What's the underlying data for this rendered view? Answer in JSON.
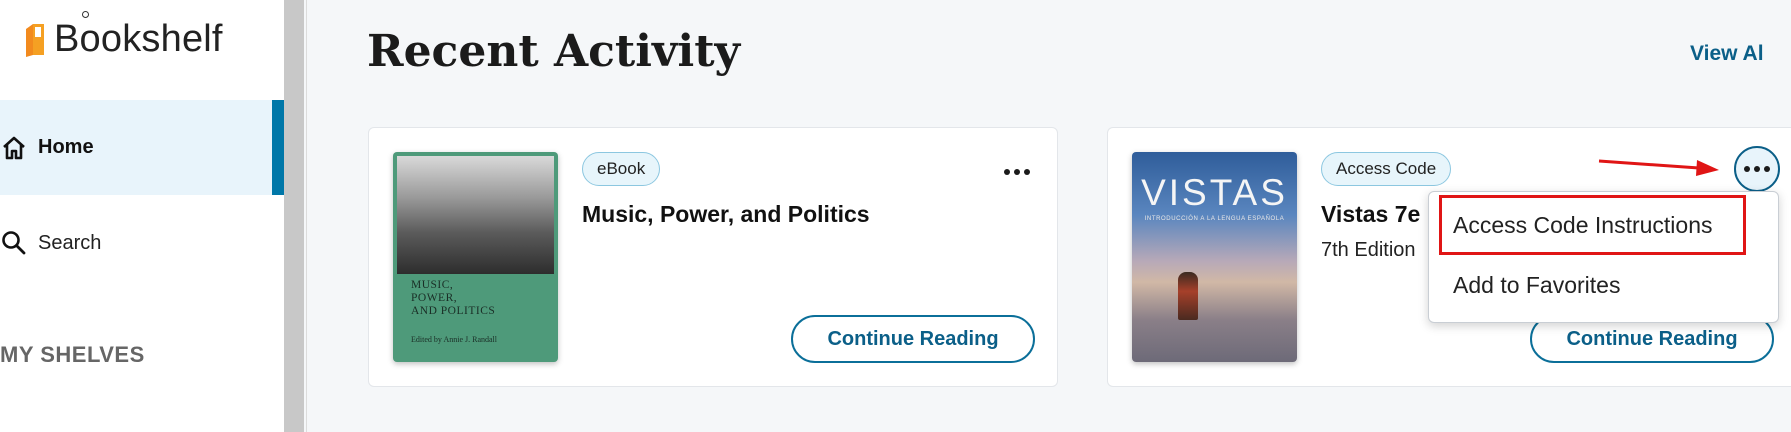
{
  "app": {
    "name": "Bookshelf"
  },
  "sidebar": {
    "items": [
      {
        "label": "Home",
        "icon": "home-icon",
        "active": true
      },
      {
        "label": "Search",
        "icon": "search-icon",
        "active": false
      }
    ],
    "section_heading": "MY SHELVES"
  },
  "main": {
    "title": "Recent Activity",
    "view_all": "View Al",
    "cards": [
      {
        "tag": "eBook",
        "title": "Music, Power, and Politics",
        "edition": "",
        "cover_title_lines": [
          "MUSIC,",
          "POWER,",
          "AND POLITICS"
        ],
        "cover_editor": "Edited by Annie J. Randall",
        "button": "Continue Reading"
      },
      {
        "tag": "Access Code",
        "title": "Vistas 7e",
        "edition": "7th Edition",
        "cover_title": "VISTAS",
        "cover_subtitle": "INTRODUCCIÓN A LA LENGUA ESPAÑOLA",
        "button": "Continue Reading"
      }
    ]
  },
  "menu": {
    "items": [
      "Access Code Instructions",
      "Add to Favorites"
    ]
  },
  "colors": {
    "accent": "#0b5f88",
    "highlight": "#e01515",
    "active_bg": "#e8f4fb"
  }
}
